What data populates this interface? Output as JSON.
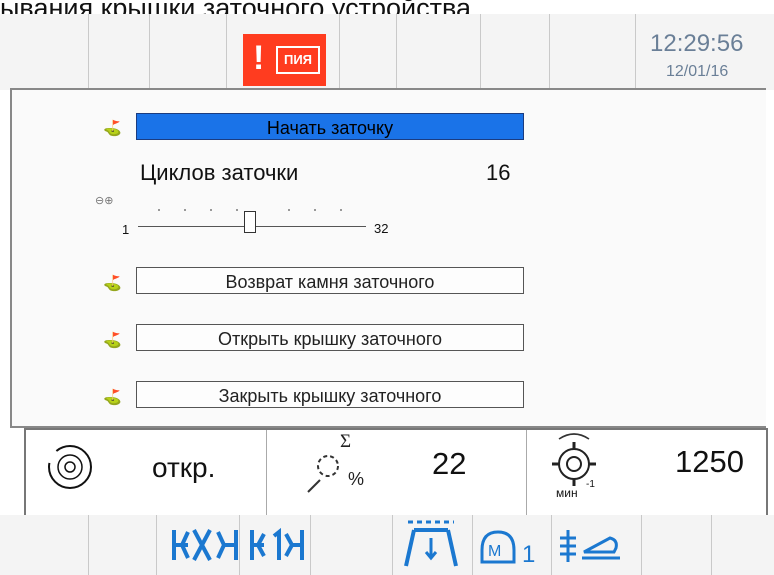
{
  "caption": "ывания крышки заточного устройства.",
  "header": {
    "clock": "12:29:56",
    "date": "12/01/16",
    "alarm_label": "!",
    "alarm_box_text": "ПИЯ"
  },
  "sharpening": {
    "start_button": "Начать заточку",
    "cycles_label": "Циклов заточки",
    "cycles_value": "16",
    "slider_min": "1",
    "slider_max": "32",
    "slider_value_fraction": 0.47,
    "return_stone_button": "Возврат камня заточного",
    "open_cover_button": "Открыть крышку заточного",
    "close_cover_button": "Закрыть крышку заточного"
  },
  "status": {
    "cover_state": "откр.",
    "sharpen_count": "22",
    "rpm_value": "1250",
    "rpm_unit": "мин"
  },
  "icons": {
    "hand": "hand-icon",
    "cover": "cover-icon",
    "gear_sum": "sharpen-counter-icon",
    "speed": "speed-icon"
  },
  "colors": {
    "accent_blue": "#1a73e8",
    "alarm_red": "#ff3c1f",
    "toolbar_blue": "#1b78d0"
  }
}
